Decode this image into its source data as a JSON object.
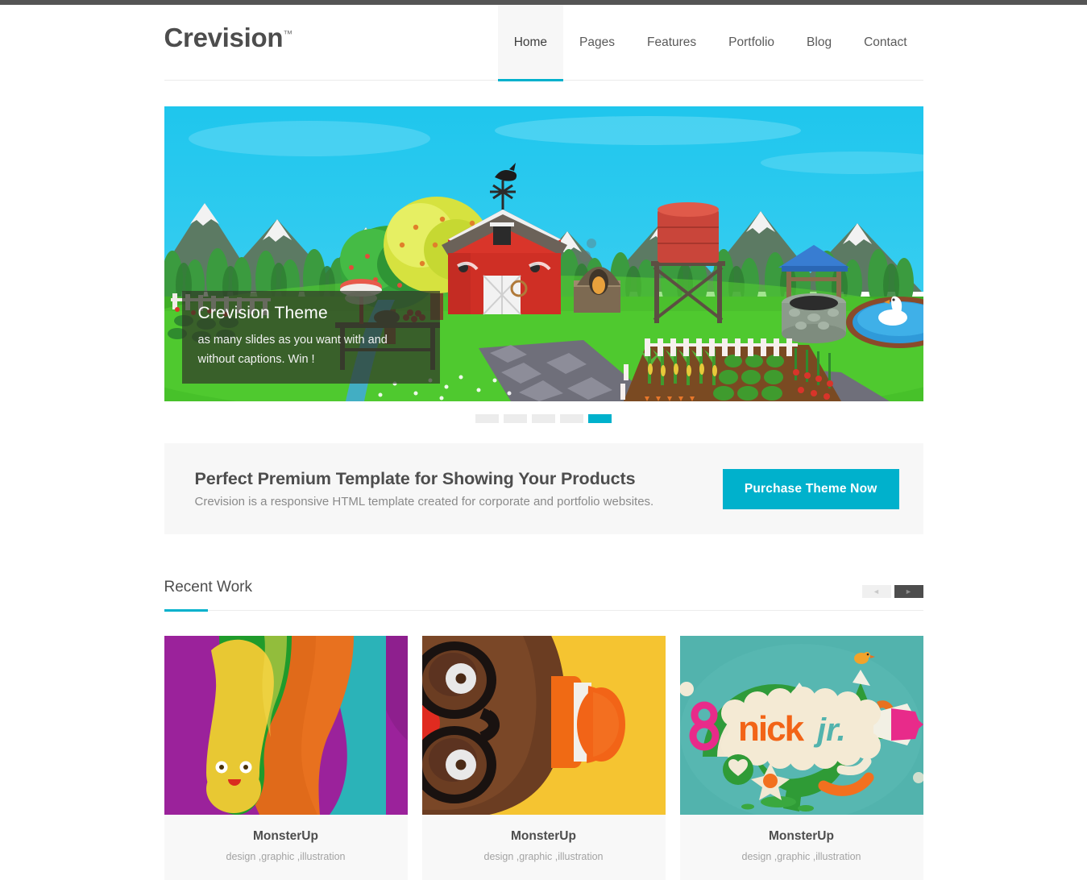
{
  "site": {
    "logo": "Crevision",
    "logo_tm": "™",
    "accent_color": "#00b1cc"
  },
  "nav": {
    "items": [
      {
        "label": "Home",
        "active": true
      },
      {
        "label": "Pages",
        "active": false
      },
      {
        "label": "Features",
        "active": false
      },
      {
        "label": "Portfolio",
        "active": false
      },
      {
        "label": "Blog",
        "active": false
      },
      {
        "label": "Contact",
        "active": false
      }
    ]
  },
  "slider": {
    "caption_title": "Crevision Theme",
    "caption_text": "as many slides as you want with and without captions. Win !",
    "pager_count": 5,
    "pager_active_index": 4,
    "slide_alt": "farm-illustration"
  },
  "promo": {
    "heading": "Perfect Premium Template for Showing Your Products",
    "subheading": "Crevision is a responsive HTML template created for corporate and portfolio websites.",
    "button_label": "Purchase Theme Now"
  },
  "recent_work": {
    "title": "Recent Work",
    "prev_label": "◄",
    "next_label": "►",
    "cards": [
      {
        "title": "MonsterUp",
        "subtitle": "design ,graphic ,illustration",
        "image_alt": "colorful-drip-blobs-artwork"
      },
      {
        "title": "MonsterUp",
        "subtitle": "design ,graphic ,illustration",
        "image_alt": "brown-character-glasses-artwork"
      },
      {
        "title": "MonsterUp",
        "subtitle": "design ,graphic ,illustration",
        "image_alt": "nick-jr-logo-artwork"
      }
    ]
  }
}
